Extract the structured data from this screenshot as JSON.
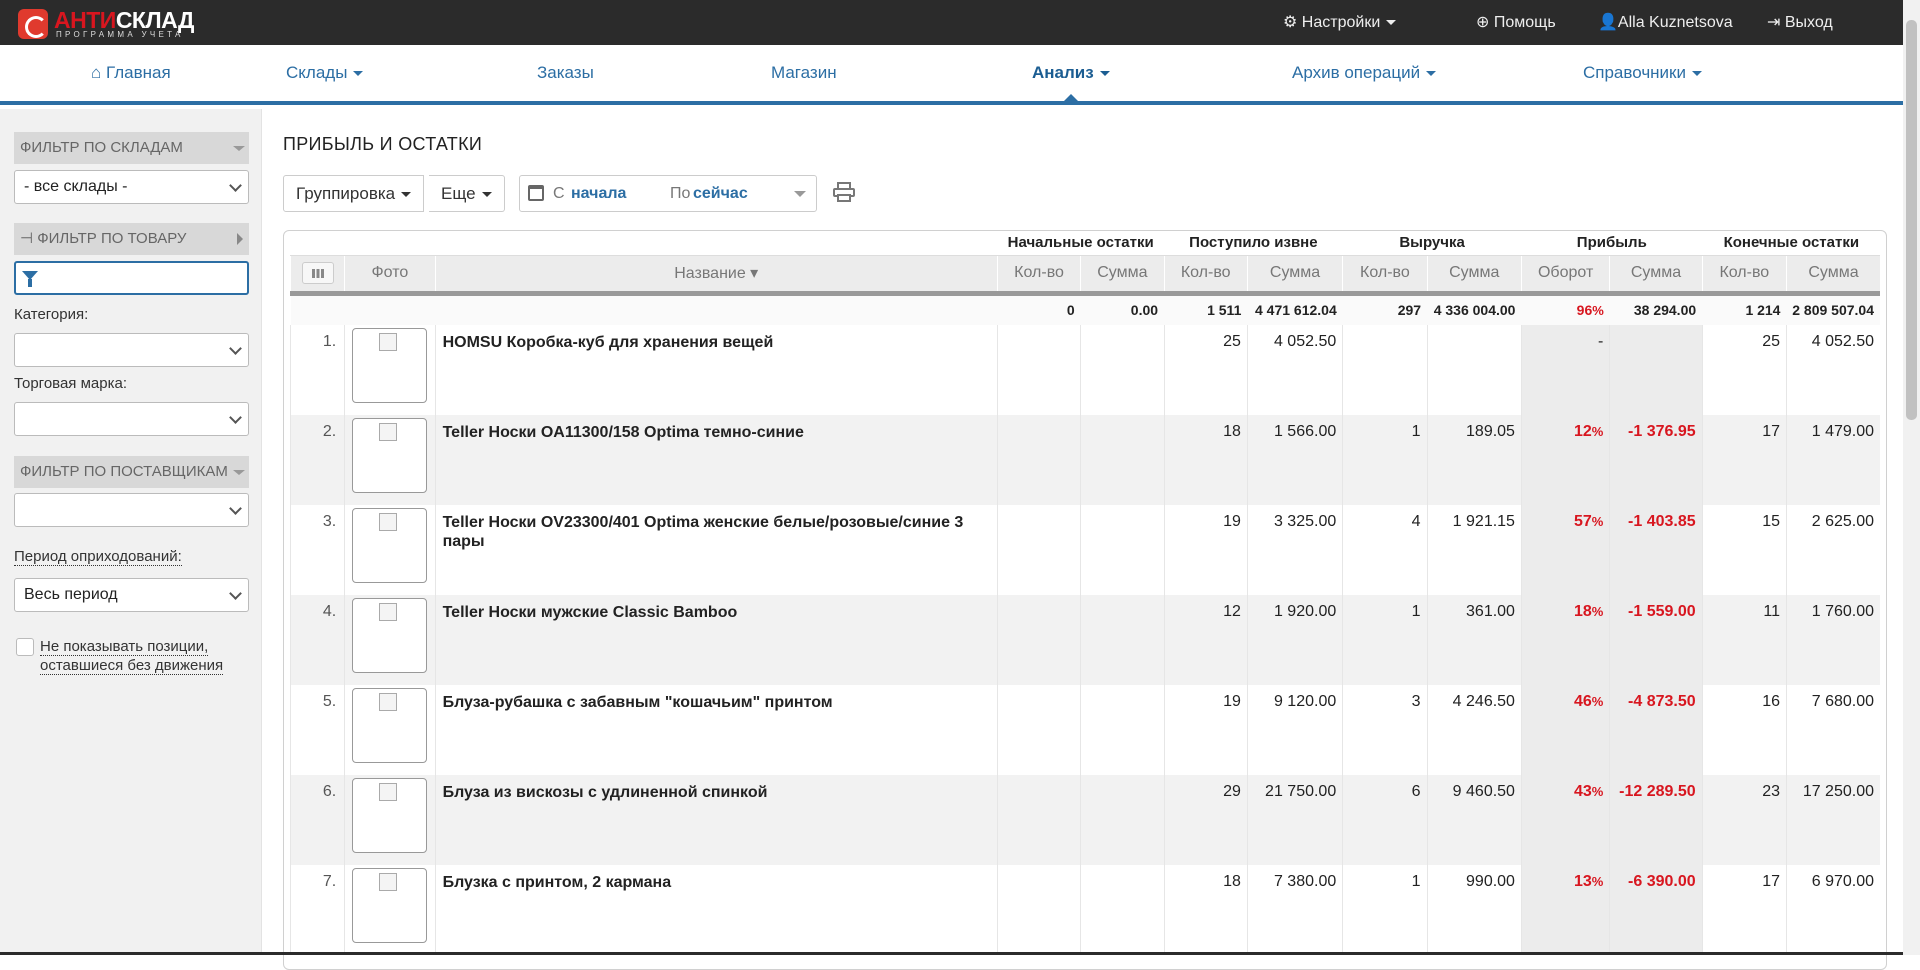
{
  "logo": {
    "brand_left": "АНТИ",
    "brand_right": "СКЛАД",
    "tagline": "ПРОГРАММА УЧЕТА"
  },
  "topbar": {
    "settings": "Настройки",
    "help": "Помощь",
    "user": "Alla Kuznetsova",
    "logout": "Выход"
  },
  "nav": {
    "home": "Главная",
    "warehouses": "Склады",
    "orders": "Заказы",
    "shop": "Магазин",
    "analysis": "Анализ",
    "archive": "Архив операций",
    "references": "Справочники"
  },
  "sidebar": {
    "filter_warehouses": "ФИЛЬТР ПО СКЛАДАМ",
    "warehouse_value": "- все склады -",
    "filter_goods": "ФИЛЬТР ПО ТОВАРУ",
    "category_label": "Категория:",
    "brand_label": "Торговая марка:",
    "filter_suppliers": "ФИЛЬТР ПО ПОСТАВЩИКАМ",
    "period_label": "Период оприходований:",
    "period_value": "Весь период",
    "hide_label_1": "Не показывать позиции,",
    "hide_label_2": "оставшиеся без движения"
  },
  "page": {
    "title": "ПРИБЫЛЬ И ОСТАТКИ",
    "grouping": "Группировка",
    "more": "Еще",
    "from_label": "С",
    "from_value": "начала",
    "to_label": "По",
    "to_value": "сейчас"
  },
  "table": {
    "groups": {
      "start": "Начальные остатки",
      "incoming": "Поступило извне",
      "revenue": "Выручка",
      "profit": "Прибыль",
      "end": "Конечные остатки"
    },
    "cols": {
      "photo": "Фото",
      "name": "Название ▾",
      "qty": "Кол-во",
      "sum": "Сумма",
      "turnover": "Оборот"
    },
    "totals": {
      "start_qty": "0",
      "start_sum": "0.00",
      "in_qty": "1 511",
      "in_sum": "4 471 612.04",
      "rev_qty": "297",
      "rev_sum": "4 336 004.00",
      "turnover": "96",
      "profit": "38 294.00",
      "end_qty": "1 214",
      "end_sum": "2 809 507.04"
    },
    "rows": [
      {
        "n": "1.",
        "name": "HOMSU Коробка-куб для хранения вещей",
        "in_qty": "25",
        "in_sum": "4 052.50",
        "rev_qty": "",
        "rev_sum": "",
        "turnover": "-",
        "profit": "",
        "end_qty": "25",
        "end_sum": "4 052.50"
      },
      {
        "n": "2.",
        "name": "Teller Носки OA11300/158 Optima темно-синие",
        "in_qty": "18",
        "in_sum": "1 566.00",
        "rev_qty": "1",
        "rev_sum": "189.05",
        "turnover": "12",
        "profit": "-1 376.95",
        "end_qty": "17",
        "end_sum": "1 479.00"
      },
      {
        "n": "3.",
        "name": "Teller Носки OV23300/401 Optima женские белые/розовые/синие 3 пары",
        "in_qty": "19",
        "in_sum": "3 325.00",
        "rev_qty": "4",
        "rev_sum": "1 921.15",
        "turnover": "57",
        "profit": "-1 403.85",
        "end_qty": "15",
        "end_sum": "2 625.00"
      },
      {
        "n": "4.",
        "name": "Teller Носки мужские Classic Bamboo",
        "in_qty": "12",
        "in_sum": "1 920.00",
        "rev_qty": "1",
        "rev_sum": "361.00",
        "turnover": "18",
        "profit": "-1 559.00",
        "end_qty": "11",
        "end_sum": "1 760.00"
      },
      {
        "n": "5.",
        "name": "Блуза-рубашка с забавным \"кошачьим\" принтом",
        "in_qty": "19",
        "in_sum": "9 120.00",
        "rev_qty": "3",
        "rev_sum": "4 246.50",
        "turnover": "46",
        "profit": "-4 873.50",
        "end_qty": "16",
        "end_sum": "7 680.00"
      },
      {
        "n": "6.",
        "name": "Блуза из вискозы с удлиненной спинкой",
        "in_qty": "29",
        "in_sum": "21 750.00",
        "rev_qty": "6",
        "rev_sum": "9 460.50",
        "turnover": "43",
        "profit": "-12 289.50",
        "end_qty": "23",
        "end_sum": "17 250.00"
      },
      {
        "n": "7.",
        "name": "Блузка с принтом, 2 кармана",
        "in_qty": "18",
        "in_sum": "7 380.00",
        "rev_qty": "1",
        "rev_sum": "990.00",
        "turnover": "13",
        "profit": "-6 390.00",
        "end_qty": "17",
        "end_sum": "6 970.00"
      }
    ]
  },
  "colors": {
    "accent": "#2c6ea4",
    "negative": "#d8161f",
    "topbar": "#2b2b2b"
  }
}
